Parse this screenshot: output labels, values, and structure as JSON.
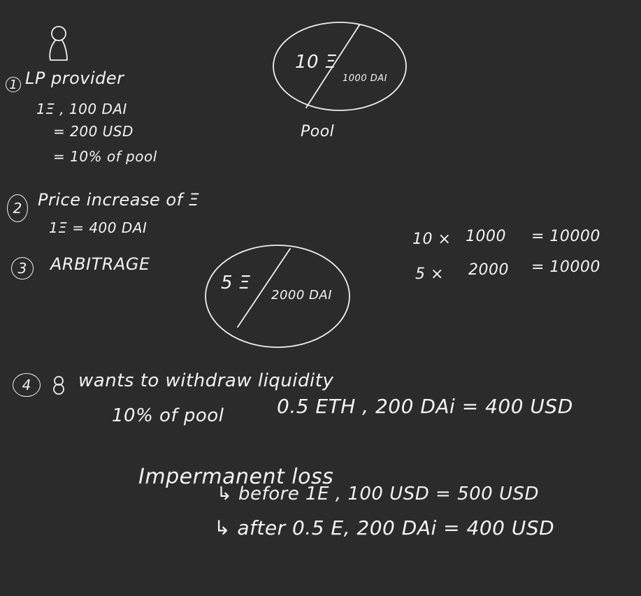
{
  "user_figure_icon": "person-icon",
  "lp": {
    "num": "1",
    "title": "LP provider",
    "line1": "1Ξ , 100 DAI",
    "line2": "= 200 USD",
    "line3": "= 10% of pool"
  },
  "pool1": {
    "left": "10 Ξ",
    "right": "1000 DAI",
    "caption": "Pool"
  },
  "step2": {
    "num": "2",
    "title": "Price increase of Ξ",
    "line1": "1Ξ = 400 DAI"
  },
  "step3": {
    "num": "3",
    "title": "ARBITRAGE"
  },
  "pool2": {
    "left": "5 Ξ",
    "right": "2000 DAI"
  },
  "math": {
    "row1_a": "10 ×",
    "row1_b": "1000",
    "row1_c": "= 10000",
    "row2_a": "5 ×",
    "row2_b": "2000",
    "row2_c": "= 10000"
  },
  "step4": {
    "num": "4",
    "title": "wants to withdraw liquidity",
    "share": "10% of pool",
    "result": "0.5 ETH , 200 DAi = 400 USD"
  },
  "il": {
    "title": "Impermanent loss",
    "before": "↳ before 1E , 100 USD = 500 USD",
    "after": "↳ after 0.5 E, 200 DAi = 400 USD"
  }
}
